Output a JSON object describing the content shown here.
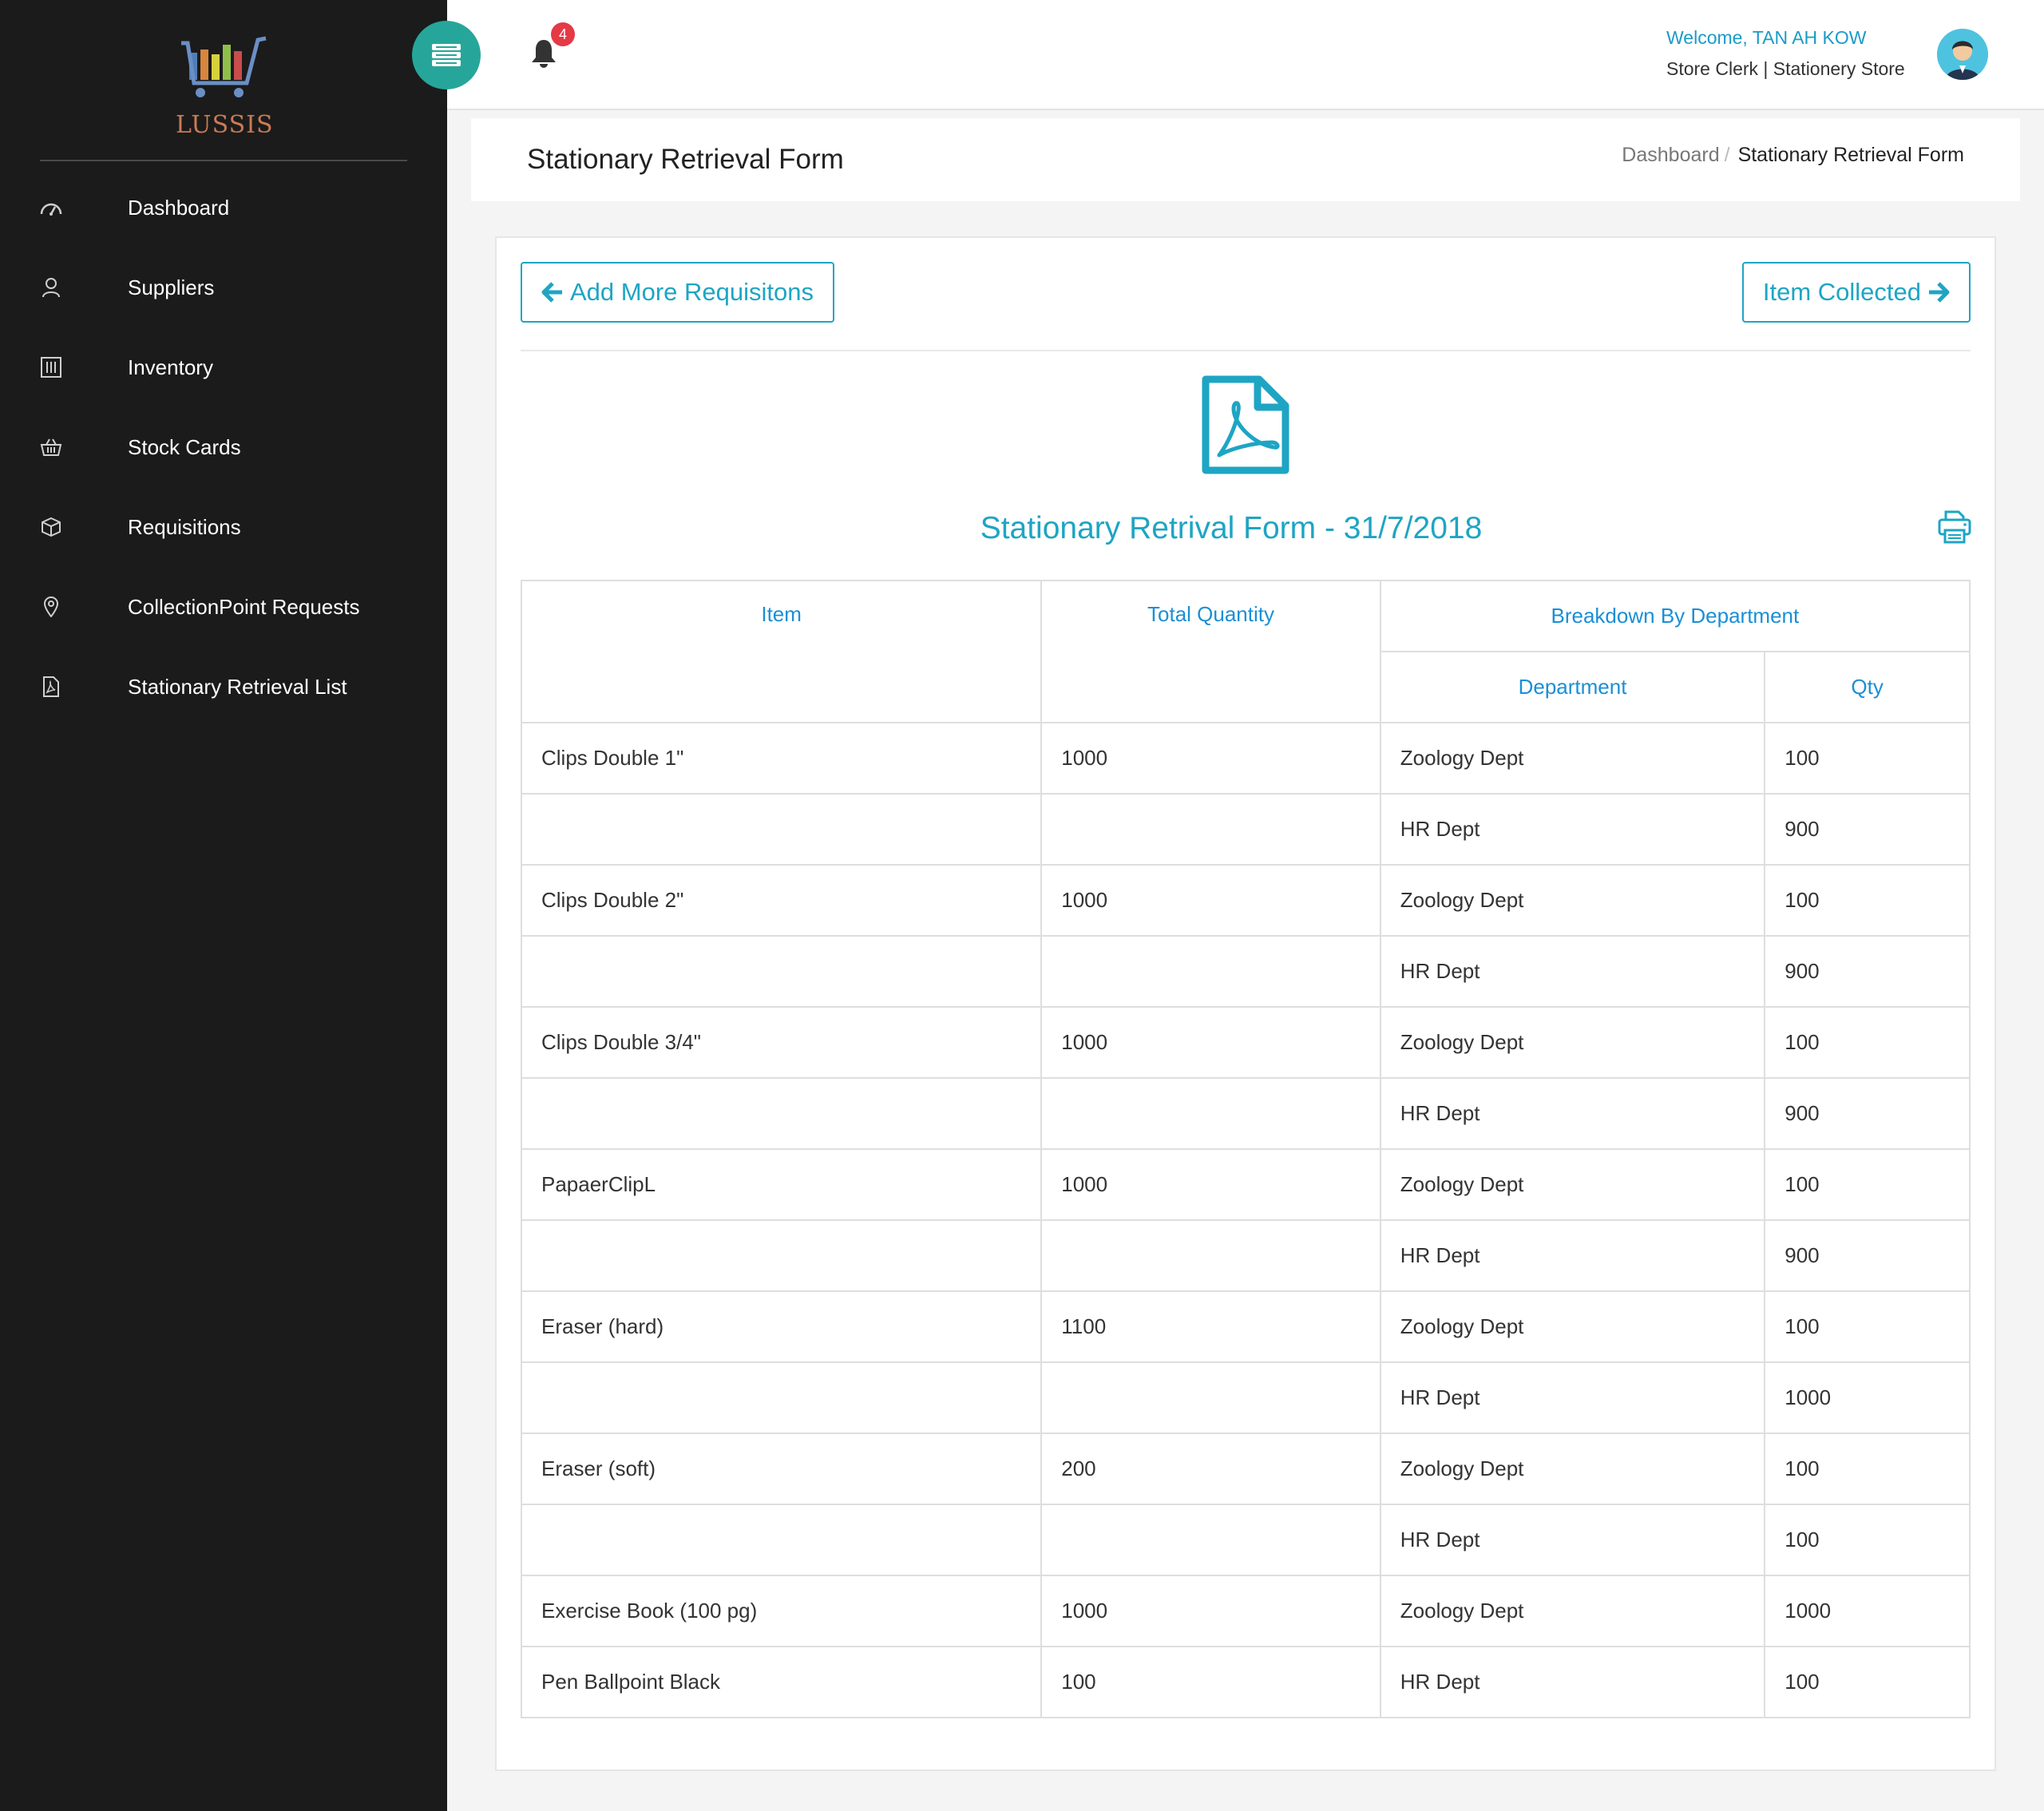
{
  "app": {
    "logo_text": "LUSSIS"
  },
  "sidebar": {
    "items": [
      {
        "label": "Dashboard",
        "icon": "dashboard-icon"
      },
      {
        "label": "Suppliers",
        "icon": "user-icon"
      },
      {
        "label": "Inventory",
        "icon": "equalizer-icon"
      },
      {
        "label": "Stock Cards",
        "icon": "basket-icon"
      },
      {
        "label": "Requisitions",
        "icon": "package-icon"
      },
      {
        "label": "CollectionPoint Requests",
        "icon": "location-pin-icon"
      },
      {
        "label": "Stationary Retrieval List",
        "icon": "pdf-file-icon"
      }
    ]
  },
  "topbar": {
    "notification_count": "4",
    "welcome": "Welcome, TAN AH KOW",
    "role": "Store Clerk | Stationery Store"
  },
  "page": {
    "title": "Stationary Retrieval Form",
    "breadcrumb": {
      "home": "Dashboard",
      "separator": "/",
      "current": "Stationary Retrieval Form"
    }
  },
  "actions": {
    "add_more": "Add More Requisitons",
    "item_collected": "Item Collected"
  },
  "form": {
    "title": "Stationary Retrival Form - 31/7/2018",
    "headers": {
      "item": "Item",
      "total_quantity": "Total Quantity",
      "breakdown": "Breakdown By Department",
      "department": "Department",
      "qty": "Qty"
    },
    "rows": [
      {
        "item": "Clips Double 1\"",
        "total": "1000",
        "dept": "Zoology Dept",
        "qty": "100"
      },
      {
        "item": "",
        "total": "",
        "dept": "HR Dept",
        "qty": "900"
      },
      {
        "item": "Clips Double 2\"",
        "total": "1000",
        "dept": "Zoology Dept",
        "qty": "100"
      },
      {
        "item": "",
        "total": "",
        "dept": "HR Dept",
        "qty": "900"
      },
      {
        "item": "Clips Double 3/4\"",
        "total": "1000",
        "dept": "Zoology Dept",
        "qty": "100"
      },
      {
        "item": "",
        "total": "",
        "dept": "HR Dept",
        "qty": "900"
      },
      {
        "item": "PapaerClipL",
        "total": "1000",
        "dept": "Zoology Dept",
        "qty": "100"
      },
      {
        "item": "",
        "total": "",
        "dept": "HR Dept",
        "qty": "900"
      },
      {
        "item": "Eraser (hard)",
        "total": "1100",
        "dept": "Zoology Dept",
        "qty": "100"
      },
      {
        "item": "",
        "total": "",
        "dept": "HR Dept",
        "qty": "1000"
      },
      {
        "item": "Eraser (soft)",
        "total": "200",
        "dept": "Zoology Dept",
        "qty": "100"
      },
      {
        "item": "",
        "total": "",
        "dept": "HR Dept",
        "qty": "100"
      },
      {
        "item": "Exercise Book (100 pg)",
        "total": "1000",
        "dept": "Zoology Dept",
        "qty": "1000"
      },
      {
        "item": "Pen Ballpoint Black",
        "total": "100",
        "dept": "HR Dept",
        "qty": "100"
      }
    ]
  },
  "colors": {
    "sidebar_bg": "#1b1b1b",
    "accent": "#1ea5c4",
    "toggle": "#26a69a",
    "header_text": "#1a8fd6",
    "badge": "#e53945"
  }
}
